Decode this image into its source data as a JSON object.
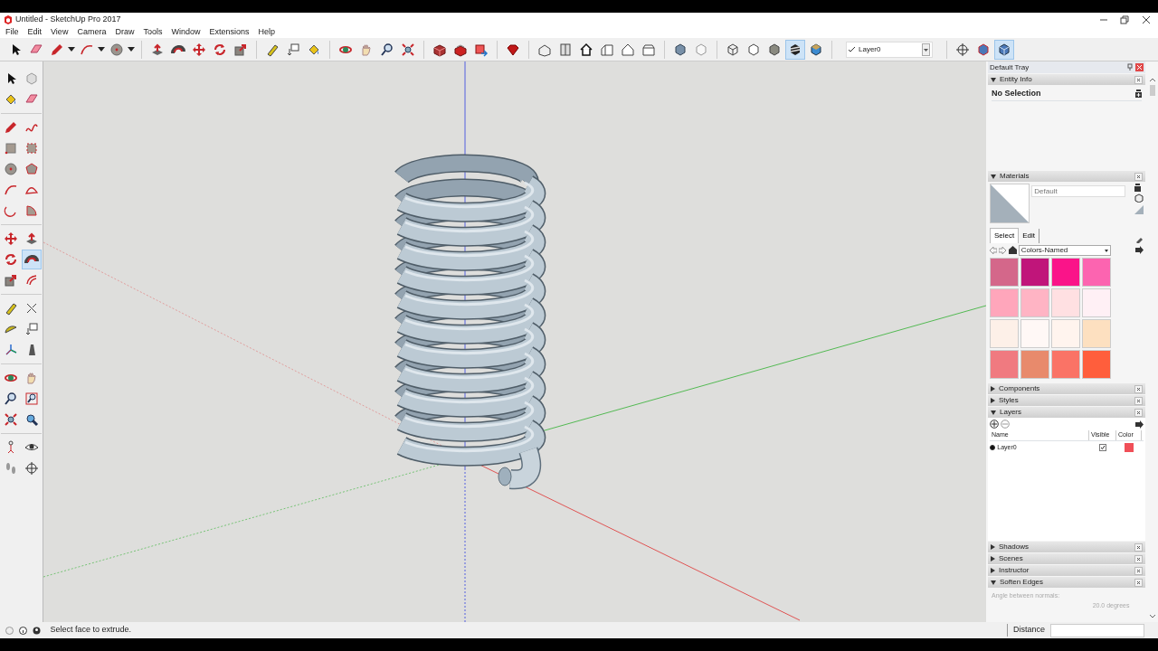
{
  "window": {
    "title": "Untitled - SketchUp Pro 2017"
  },
  "menu": [
    "File",
    "Edit",
    "View",
    "Camera",
    "Draw",
    "Tools",
    "Window",
    "Extensions",
    "Help"
  ],
  "main_toolbar": [
    {
      "selected": false
    },
    {
      "selected": false
    },
    {
      "selected": false
    },
    {
      "selected": false
    },
    {
      "selected": false
    },
    {
      "selected": false
    },
    {
      "selected": false
    },
    {
      "selected": false
    },
    {
      "selected": false
    },
    {
      "selected": false
    },
    {
      "selected": false
    },
    {
      "selected": false
    },
    {
      "selected": false
    },
    {
      "selected": false
    },
    {
      "selected": false
    },
    {
      "selected": false
    },
    {
      "selected": false
    },
    {
      "selected": false
    },
    {
      "selected": false
    },
    {
      "selected": false
    },
    {
      "selected": false
    },
    {
      "selected": false
    },
    {
      "selected": false
    },
    {
      "selected": false
    },
    {
      "selected": false
    },
    {
      "selected": false
    },
    {
      "selected": false
    },
    {
      "selected": false
    },
    {
      "selected": false
    },
    {
      "selected": false
    },
    {
      "selected": false
    },
    {
      "selected": false
    },
    {
      "selected": true
    },
    {
      "selected": false
    }
  ],
  "layer_dropdown": {
    "value": "Layer0"
  },
  "view_toolbar": [
    {
      "selected": false
    },
    {
      "selected": false
    },
    {
      "selected": true
    }
  ],
  "left_toolbar": [
    {
      "selected": false
    },
    {
      "selected": false
    },
    {
      "selected": false
    },
    {
      "selected": false
    },
    {
      "selected": false
    },
    {
      "selected": false
    },
    {
      "selected": false
    },
    {
      "selected": false
    },
    {
      "selected": false
    },
    {
      "selected": false
    },
    {
      "selected": false
    },
    {
      "selected": false
    },
    {
      "selected": false
    },
    {
      "selected": false
    },
    {
      "selected": false
    },
    {
      "selected": false
    },
    {
      "selected": false
    },
    {
      "selected": true
    },
    {
      "selected": false
    },
    {
      "selected": false
    },
    {
      "selected": false
    },
    {
      "selected": false
    },
    {
      "selected": false
    },
    {
      "selected": false
    },
    {
      "selected": false
    },
    {
      "selected": false
    },
    {
      "selected": false
    },
    {
      "selected": false
    },
    {
      "selected": false
    },
    {
      "selected": false
    },
    {
      "selected": false
    },
    {
      "selected": false
    },
    {
      "selected": false
    },
    {
      "selected": false
    },
    {
      "selected": false
    },
    {
      "selected": false
    }
  ],
  "tray": {
    "title": "Default Tray",
    "panels": [
      {
        "kind": "entity_info",
        "title": "Entity Info",
        "expanded": true,
        "selection": "No Selection"
      },
      {
        "kind": "materials",
        "title": "Materials",
        "expanded": true,
        "name_placeholder": "Default",
        "tabs": [
          {
            "label": "Select",
            "selected": true
          },
          {
            "label": "Edit",
            "selected": false
          }
        ],
        "library": "Colors-Named",
        "swatches": [
          {
            "color": "#d4678a"
          },
          {
            "color": "#c0157a"
          },
          {
            "color": "#fa1489"
          },
          {
            "color": "#fc64b0"
          },
          {
            "color": "#ffa6bb"
          },
          {
            "color": "#ffb4c4"
          },
          {
            "color": "#ffe0e2"
          },
          {
            "color": "#fff0f5"
          },
          {
            "color": "#fdf0e8"
          },
          {
            "color": "#fff8f6"
          },
          {
            "color": "#fff4ee"
          },
          {
            "color": "#fde0c0"
          },
          {
            "color": "#f07a80"
          },
          {
            "color": "#e88a6c"
          },
          {
            "color": "#fa7366"
          },
          {
            "color": "#ff5e3c"
          }
        ]
      },
      {
        "title": "Components",
        "expanded": false
      },
      {
        "title": "Styles",
        "expanded": false
      },
      {
        "kind": "layers",
        "title": "Layers",
        "expanded": true,
        "columns": [
          "Name",
          "Visible",
          "Color"
        ],
        "rows": [
          {
            "name": "Layer0",
            "selected": true,
            "visible": true,
            "color": "#f04f58"
          }
        ]
      },
      {
        "title": "Shadows",
        "expanded": false
      },
      {
        "title": "Scenes",
        "expanded": false
      },
      {
        "title": "Instructor",
        "expanded": false
      },
      {
        "kind": "soften_edges",
        "title": "Soften Edges",
        "expanded": true,
        "label": "Angle between normals:",
        "reading": "20.0 degrees"
      }
    ]
  },
  "status_bar": {
    "message": "Select face to extrude.",
    "measure_label": "Distance"
  }
}
